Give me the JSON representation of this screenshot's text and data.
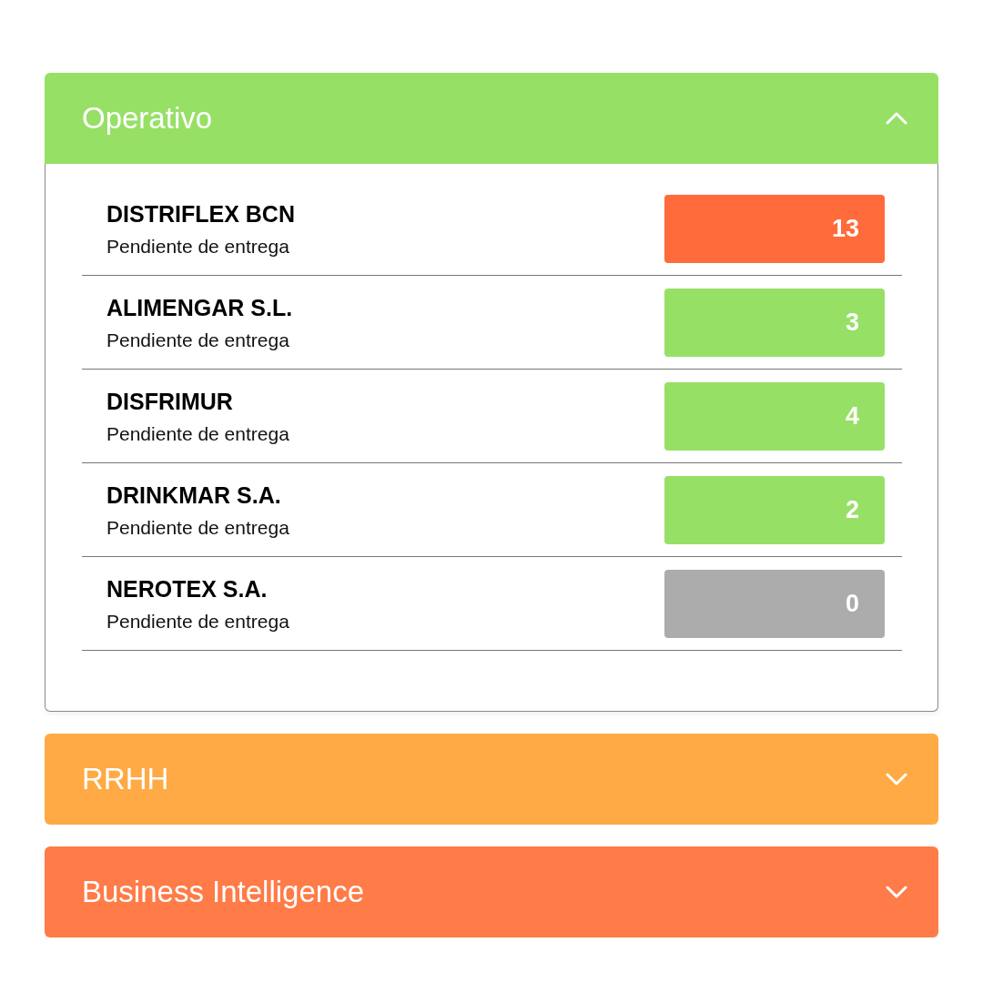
{
  "sections": [
    {
      "title": "Operativo",
      "color": "#97e066",
      "expanded": true,
      "items": [
        {
          "name": "DISTRIFLEX BCN",
          "status": "Pendiente de entrega",
          "count": "13",
          "color": "#ff6b3b"
        },
        {
          "name": "ALIMENGAR S.L.",
          "status": "Pendiente de entrega",
          "count": "3",
          "color": "#97e066"
        },
        {
          "name": "DISFRIMUR",
          "status": "Pendiente de entrega",
          "count": "4",
          "color": "#97e066"
        },
        {
          "name": "DRINKMAR S.A.",
          "status": "Pendiente de entrega",
          "count": "2",
          "color": "#97e066"
        },
        {
          "name": "NEROTEX S.A.",
          "status": "Pendiente de entrega",
          "count": "0",
          "color": "#acacac"
        }
      ]
    },
    {
      "title": "RRHH",
      "color": "#ffaa44",
      "expanded": false
    },
    {
      "title": "Business Intelligence",
      "color": "#ff7b47",
      "expanded": false
    }
  ]
}
